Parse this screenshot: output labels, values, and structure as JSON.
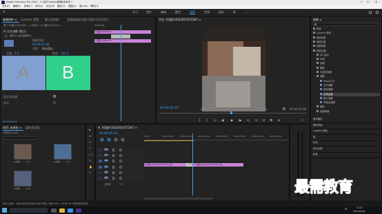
{
  "window": {
    "title": "Adobe Premiere Pro 2020 - C:\\用户\\Video\\剪辑\\未命名 *",
    "min": "—",
    "max": "☐",
    "close": "✕"
  },
  "menu": [
    "文件(F)",
    "编辑(E)",
    "剪辑(C)",
    "序列(S)",
    "标记(M)",
    "图形(G)",
    "视图(V)",
    "窗口(W)",
    "帮助(H)"
  ],
  "workspaces": {
    "home": "⌂",
    "items": [
      "学习",
      "组件",
      "编辑",
      "颜色",
      "效果",
      "音频",
      "图形",
      "库"
    ],
    "active_index": 4,
    "more": "»"
  },
  "effect_controls": {
    "tabs": [
      "效果控件 ≡",
      "Lumetri 范围",
      "源:(无剪辑)",
      "音频剪辑混合器:01图片2022051"
    ],
    "source_line": "源 * 01图片2022051... ▸ 序列01 * 01图片2022051...",
    "mini_time": "00:00:00",
    "mini_clip": "01图片2022051...",
    "effect_name": "fx 交叉溶解 (默认)",
    "desc": "图像 A 淡化到图像 B。",
    "duration_label": "持续时间",
    "duration_value": "00:00:01:00",
    "align_label": "对齐:",
    "align_value": "中心切入",
    "start_label": "开始:",
    "start_value": "0.0",
    "end_label": "结束:",
    "end_value": "100.0",
    "label_a": "A",
    "label_b": "B",
    "show_actual": "显示实际源",
    "reverse": "反向",
    "bottom_time": "00:00:00:00"
  },
  "program": {
    "tab": "节目: 01图片2022051071567 ≡",
    "timecode": "00:00:02:23",
    "fit": "适合",
    "quality": "1/2",
    "end_time": "00:00:05:00",
    "transport": [
      "{",
      "}",
      "|←",
      "◀|",
      "▶",
      "|▶",
      "→|",
      "⊡",
      "⊟",
      "⧉",
      "⊕",
      "+"
    ]
  },
  "project": {
    "tabs": [
      "项目: 未命名 ≡",
      "媒体浏览器"
    ],
    "file": "未命名.prproj",
    "items": [
      {
        "name": "01图片...",
        "duration": "5:00"
      },
      {
        "name": "01图片...",
        "duration": "5:00"
      },
      {
        "name": "01图片...",
        "duration": "5:00"
      }
    ]
  },
  "tools": [
    "▶",
    "⇉",
    "↔",
    "✂",
    "⟷",
    "✎",
    "✋",
    "T"
  ],
  "timeline": {
    "tab": "01图片2022051071567 ≡",
    "timecode": "00:00:02:23",
    "ruler": [
      "00:00",
      "00:00:05:00",
      "00:00:10:00",
      "00:00:15:00",
      "00:00:20:00",
      "00:00:25:00",
      "00:00:30:00",
      "00:00:35:00"
    ],
    "tracks": [
      {
        "id": "V3",
        "type": "video"
      },
      {
        "id": "V2",
        "type": "video"
      },
      {
        "id": "V1",
        "type": "video"
      },
      {
        "id": "A1",
        "type": "audio"
      },
      {
        "id": "A2",
        "type": "audio"
      },
      {
        "id": "A3",
        "type": "audio"
      }
    ],
    "master": "主声道",
    "master_value": "0.0",
    "clip1": "01图片2022051071567.jpg",
    "transition": "交叉溶解",
    "clip2": "01图片2022051071567.jpg"
  },
  "effects": {
    "tab": "效果 ≡",
    "tree": [
      {
        "label": "预设",
        "indent": 0,
        "type": "folder"
      },
      {
        "label": "Lumetri 预设",
        "indent": 0,
        "type": "folder"
      },
      {
        "label": "音频效果",
        "indent": 0,
        "type": "folder"
      },
      {
        "label": "音频过渡",
        "indent": 0,
        "type": "folder"
      },
      {
        "label": "视频效果",
        "indent": 0,
        "type": "folder"
      },
      {
        "label": "视频过渡",
        "indent": 0,
        "type": "folder"
      },
      {
        "label": "3D 运动",
        "indent": 1,
        "type": "folder"
      },
      {
        "label": "内滑",
        "indent": 1,
        "type": "folder"
      },
      {
        "label": "划像",
        "indent": 1,
        "type": "folder"
      },
      {
        "label": "擦除",
        "indent": 1,
        "type": "folder"
      },
      {
        "label": "沉浸式视频",
        "indent": 1,
        "type": "folder"
      },
      {
        "label": "溶解",
        "indent": 1,
        "type": "folder"
      },
      {
        "label": "MorphCut",
        "indent": 2,
        "type": "fx"
      },
      {
        "label": "交叉溶解",
        "indent": 2,
        "type": "fx"
      },
      {
        "label": "叠加溶解",
        "indent": 2,
        "type": "fx"
      },
      {
        "label": "白场过渡",
        "indent": 2,
        "type": "fx"
      },
      {
        "label": "胶片溶解",
        "indent": 2,
        "type": "fx"
      },
      {
        "label": "非叠加溶解",
        "indent": 2,
        "type": "fx"
      },
      {
        "label": "缩放",
        "indent": 1,
        "type": "folder"
      },
      {
        "label": "页面剥落",
        "indent": 1,
        "type": "folder"
      }
    ],
    "selected_index": 15,
    "panels": [
      "基本图形",
      "基本声音",
      "Lumetri 颜色",
      "库",
      "标记",
      "历史记录",
      "信息"
    ]
  },
  "watermark": "最需教育",
  "status": "单击以选择，或单击空白处并拖动以进行框选。使用 Shift、Alt 和 Ctrl 可获得其他选项。",
  "taskbar": {
    "time": "17:21",
    "date": "2021/10/28",
    "lang": "中"
  },
  "colors": {
    "accent": "#3b9ef5",
    "clip": "#c783d7",
    "imageA": "#7fa0d0",
    "imageB": "#2fd18a",
    "watermark": "#2f3f95"
  }
}
